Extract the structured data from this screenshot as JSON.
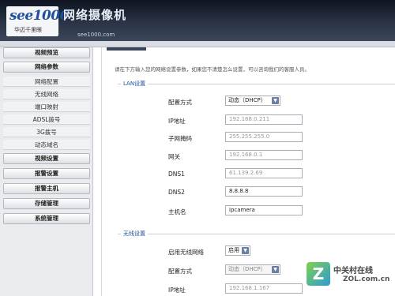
{
  "header": {
    "logo_text": "see1000",
    "logo_sub": "华迈千里眼",
    "app_title": "网络摄像机",
    "url": "see1000.com"
  },
  "sidebar": {
    "menu": [
      {
        "label": "视频预览"
      },
      {
        "label": "网络参数"
      },
      {
        "label": "视频设置"
      },
      {
        "label": "报警设置"
      },
      {
        "label": "报警主机"
      },
      {
        "label": "存储管理"
      },
      {
        "label": "系统管理"
      }
    ],
    "sub_items": [
      {
        "label": "网络配置"
      },
      {
        "label": "无线网络"
      },
      {
        "label": "端口映射"
      },
      {
        "label": "ADSL拨号"
      },
      {
        "label": "3G拨号"
      },
      {
        "label": "动态域名"
      }
    ]
  },
  "content": {
    "intro": "请在下方输入您的网络设置参数，如果您不清楚怎么设置，可以咨询我们的客服人员。",
    "lan": {
      "title": "LAN设置",
      "config_label": "配置方式",
      "config_value": "动态（DHCP）",
      "ip_label": "IP地址",
      "ip_value": "192.168.0.211",
      "mask_label": "子网掩码",
      "mask_value": "255.255.255.0",
      "gateway_label": "网关",
      "gateway_value": "192.168.0.1",
      "dns1_label": "DNS1",
      "dns1_value": "61.139.2.69",
      "dns2_label": "DNS2",
      "dns2_value": "8.8.8.8",
      "host_label": "主机名",
      "host_value": "ipcamera"
    },
    "wireless": {
      "title": "无线设置",
      "enable_label": "启用无线网络",
      "enable_value": "启用",
      "config_label": "配置方式",
      "config_value": "动态（DHCP）",
      "ip_label": "IP地址",
      "ip_value": "192.168.1.167"
    }
  },
  "watermark": {
    "badge": "Z",
    "cn": "中关村在线",
    "en": "ZOL.com.cn"
  }
}
